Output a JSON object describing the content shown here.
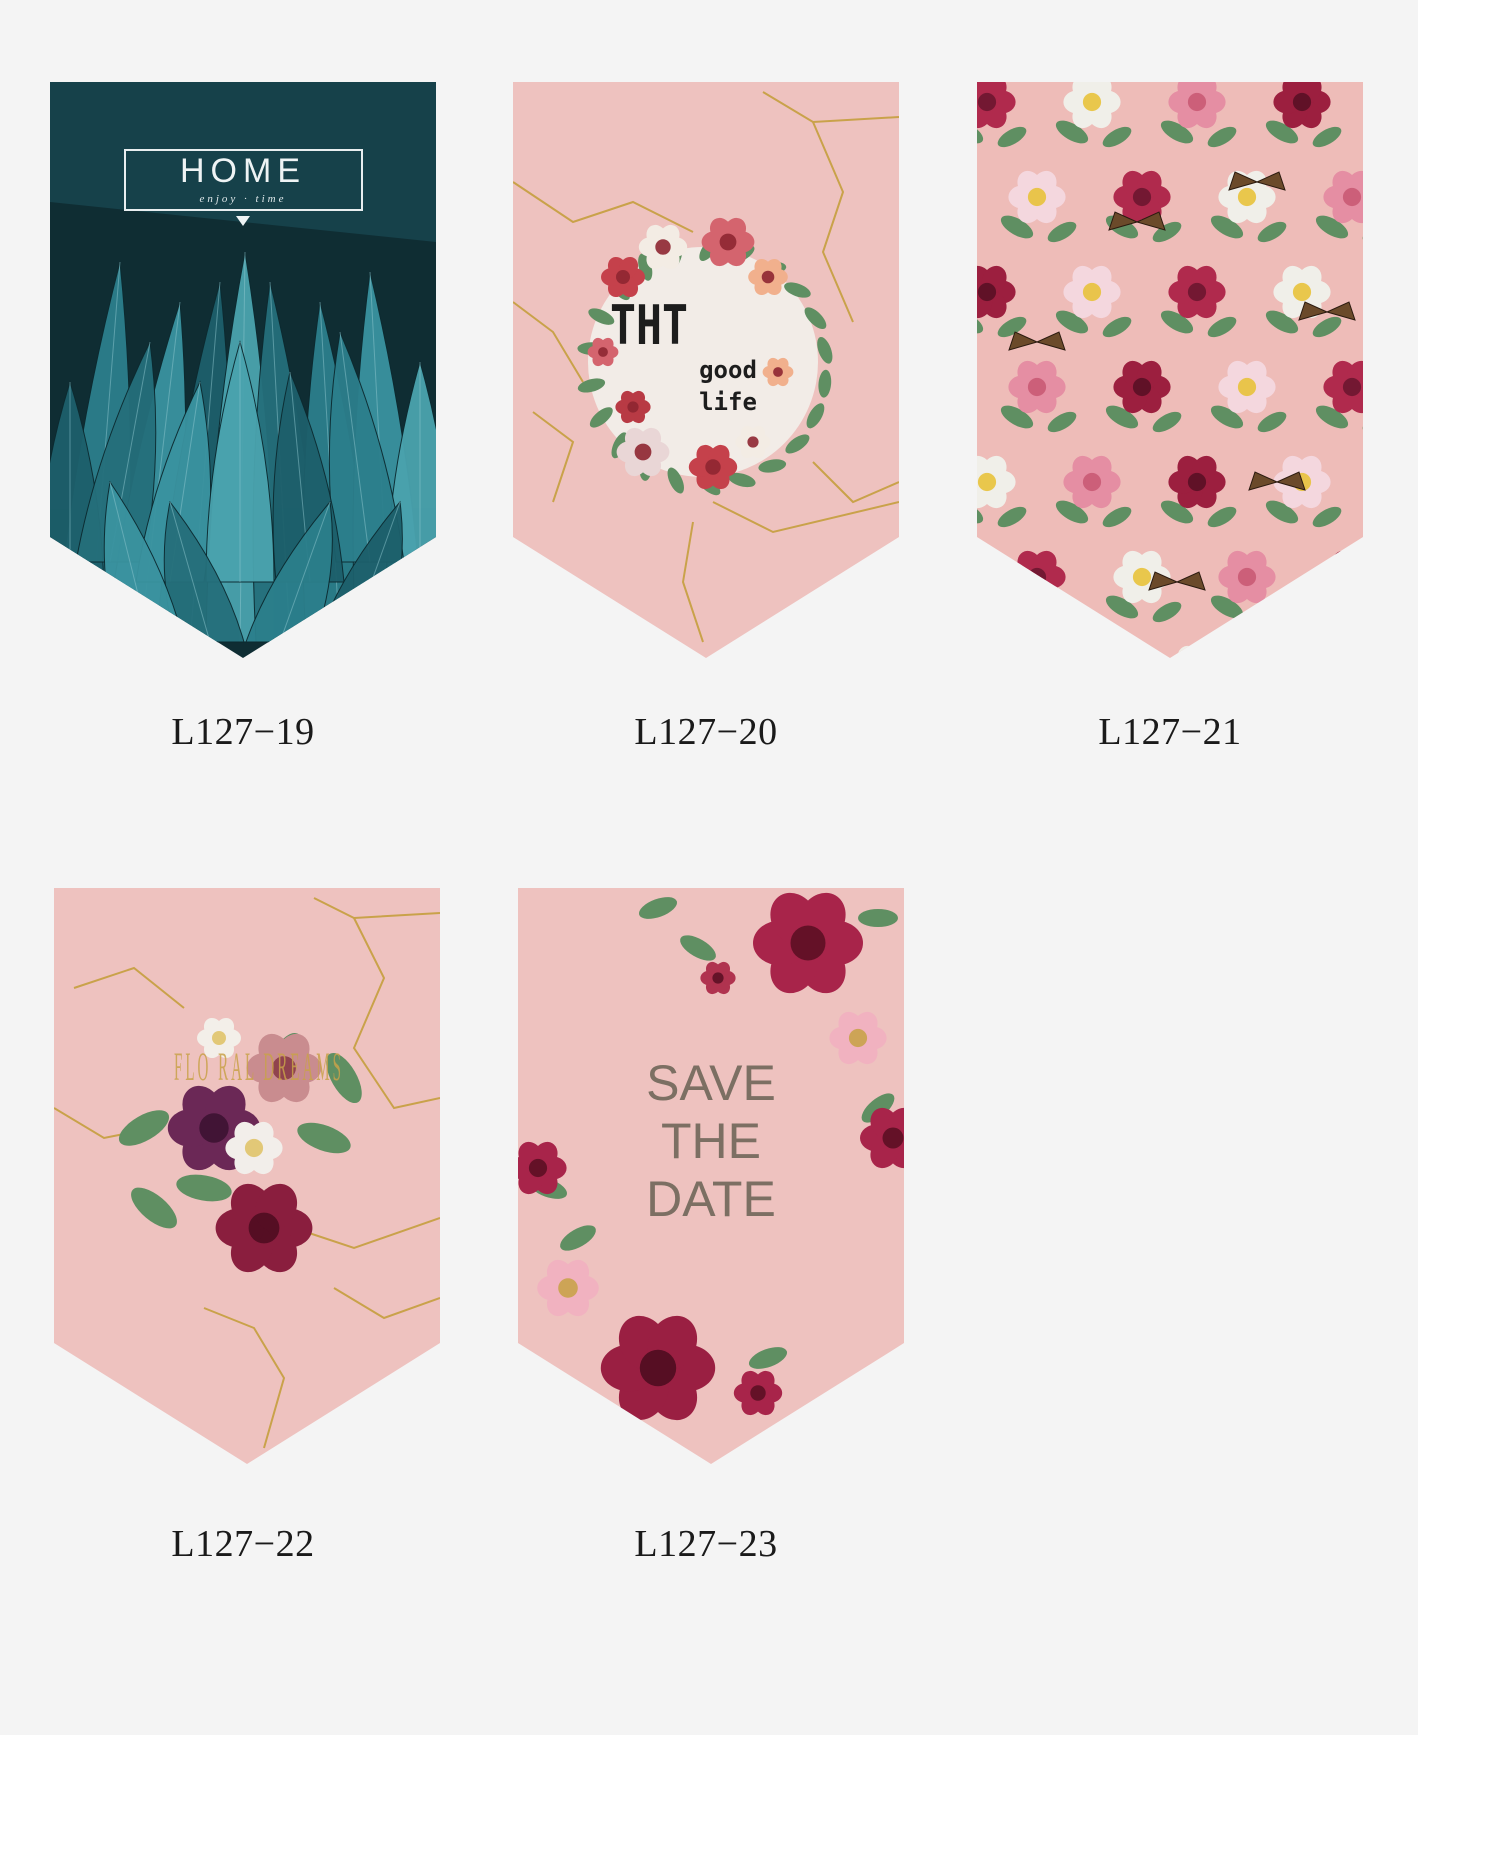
{
  "banners": [
    {
      "code": "L127−19",
      "home_text": "HOME",
      "home_sub": "enjoy · time"
    },
    {
      "code": "L127−20",
      "line1": "THT",
      "line2": "good",
      "line3": "life"
    },
    {
      "code": "L127−21"
    },
    {
      "code": "L127−22",
      "text": "FLO RAL DREAMS"
    },
    {
      "code": "L127−23",
      "line1": "SAVE",
      "line2": "THE",
      "line3": "DATE"
    }
  ],
  "colors": {
    "background": "#f4f4f4",
    "pink": "#eec2bf",
    "teal": "#1f6b78",
    "gold": "#c9a24a",
    "rose": "#a8244a"
  }
}
